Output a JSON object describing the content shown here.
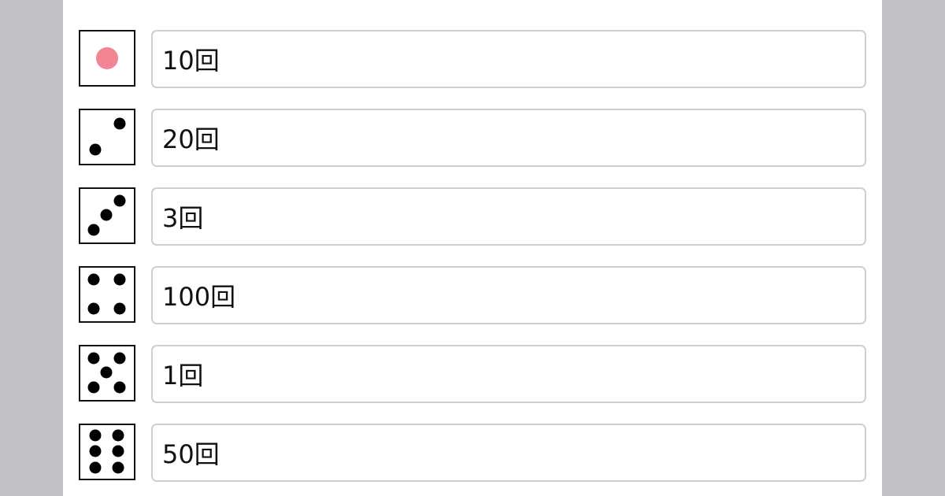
{
  "rows": [
    {
      "face": 1,
      "value": "10回",
      "pip_color": "#f28494"
    },
    {
      "face": 2,
      "value": "20回",
      "pip_color": "#000000"
    },
    {
      "face": 3,
      "value": "3回",
      "pip_color": "#000000"
    },
    {
      "face": 4,
      "value": "100回",
      "pip_color": "#000000"
    },
    {
      "face": 5,
      "value": "1回",
      "pip_color": "#000000"
    },
    {
      "face": 6,
      "value": "50回",
      "pip_color": "#000000"
    }
  ]
}
